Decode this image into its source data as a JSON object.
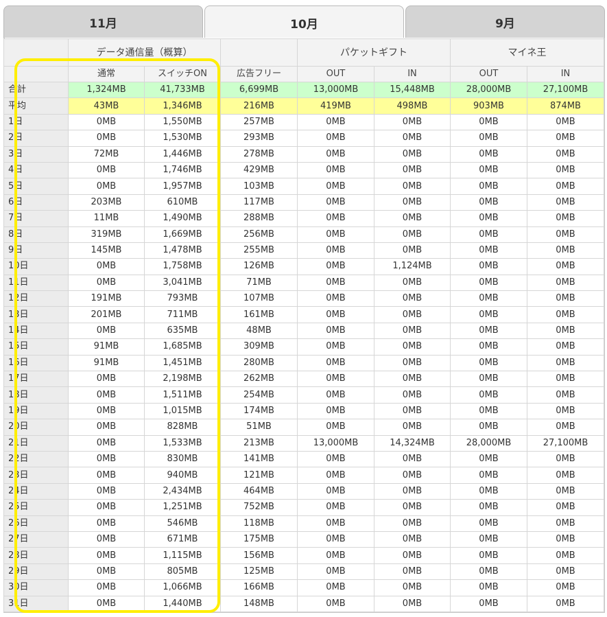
{
  "tabs": [
    {
      "label": "11月",
      "active": false
    },
    {
      "label": "10月",
      "active": true
    },
    {
      "label": "9月",
      "active": false
    }
  ],
  "header": {
    "group1": "データ通信量（概算）",
    "group2": "パケットギフト",
    "group3": "マイネ王",
    "col_normal": "通常",
    "col_switch": "スイッチON",
    "col_adfree": "広告フリー",
    "col_gift_out": "OUT",
    "col_gift_in": "IN",
    "col_mine_out": "OUT",
    "col_mine_in": "IN"
  },
  "summary": {
    "total": {
      "label": "合計",
      "values": [
        "1,324MB",
        "41,733MB",
        "6,699MB",
        "13,000MB",
        "15,448MB",
        "28,000MB",
        "27,100MB"
      ]
    },
    "average": {
      "label": "平均",
      "values": [
        "43MB",
        "1,346MB",
        "216MB",
        "419MB",
        "498MB",
        "903MB",
        "874MB"
      ]
    }
  },
  "rows": [
    {
      "day": "1日",
      "values": [
        "0MB",
        "1,550MB",
        "257MB",
        "0MB",
        "0MB",
        "0MB",
        "0MB"
      ]
    },
    {
      "day": "2日",
      "values": [
        "0MB",
        "1,530MB",
        "293MB",
        "0MB",
        "0MB",
        "0MB",
        "0MB"
      ]
    },
    {
      "day": "3日",
      "values": [
        "72MB",
        "1,446MB",
        "278MB",
        "0MB",
        "0MB",
        "0MB",
        "0MB"
      ]
    },
    {
      "day": "4日",
      "values": [
        "0MB",
        "1,746MB",
        "429MB",
        "0MB",
        "0MB",
        "0MB",
        "0MB"
      ]
    },
    {
      "day": "5日",
      "values": [
        "0MB",
        "1,957MB",
        "103MB",
        "0MB",
        "0MB",
        "0MB",
        "0MB"
      ]
    },
    {
      "day": "6日",
      "values": [
        "203MB",
        "610MB",
        "117MB",
        "0MB",
        "0MB",
        "0MB",
        "0MB"
      ]
    },
    {
      "day": "7日",
      "values": [
        "11MB",
        "1,490MB",
        "288MB",
        "0MB",
        "0MB",
        "0MB",
        "0MB"
      ]
    },
    {
      "day": "8日",
      "values": [
        "319MB",
        "1,669MB",
        "256MB",
        "0MB",
        "0MB",
        "0MB",
        "0MB"
      ]
    },
    {
      "day": "9日",
      "values": [
        "145MB",
        "1,478MB",
        "255MB",
        "0MB",
        "0MB",
        "0MB",
        "0MB"
      ]
    },
    {
      "day": "10日",
      "values": [
        "0MB",
        "1,758MB",
        "126MB",
        "0MB",
        "1,124MB",
        "0MB",
        "0MB"
      ]
    },
    {
      "day": "11日",
      "values": [
        "0MB",
        "3,041MB",
        "71MB",
        "0MB",
        "0MB",
        "0MB",
        "0MB"
      ]
    },
    {
      "day": "12日",
      "values": [
        "191MB",
        "793MB",
        "107MB",
        "0MB",
        "0MB",
        "0MB",
        "0MB"
      ]
    },
    {
      "day": "13日",
      "values": [
        "201MB",
        "711MB",
        "161MB",
        "0MB",
        "0MB",
        "0MB",
        "0MB"
      ]
    },
    {
      "day": "14日",
      "values": [
        "0MB",
        "635MB",
        "48MB",
        "0MB",
        "0MB",
        "0MB",
        "0MB"
      ]
    },
    {
      "day": "15日",
      "values": [
        "91MB",
        "1,685MB",
        "309MB",
        "0MB",
        "0MB",
        "0MB",
        "0MB"
      ]
    },
    {
      "day": "16日",
      "values": [
        "91MB",
        "1,451MB",
        "280MB",
        "0MB",
        "0MB",
        "0MB",
        "0MB"
      ]
    },
    {
      "day": "17日",
      "values": [
        "0MB",
        "2,198MB",
        "262MB",
        "0MB",
        "0MB",
        "0MB",
        "0MB"
      ]
    },
    {
      "day": "18日",
      "values": [
        "0MB",
        "1,511MB",
        "254MB",
        "0MB",
        "0MB",
        "0MB",
        "0MB"
      ]
    },
    {
      "day": "19日",
      "values": [
        "0MB",
        "1,015MB",
        "174MB",
        "0MB",
        "0MB",
        "0MB",
        "0MB"
      ]
    },
    {
      "day": "20日",
      "values": [
        "0MB",
        "828MB",
        "51MB",
        "0MB",
        "0MB",
        "0MB",
        "0MB"
      ]
    },
    {
      "day": "21日",
      "values": [
        "0MB",
        "1,533MB",
        "213MB",
        "13,000MB",
        "14,324MB",
        "28,000MB",
        "27,100MB"
      ]
    },
    {
      "day": "22日",
      "values": [
        "0MB",
        "830MB",
        "141MB",
        "0MB",
        "0MB",
        "0MB",
        "0MB"
      ]
    },
    {
      "day": "23日",
      "values": [
        "0MB",
        "940MB",
        "121MB",
        "0MB",
        "0MB",
        "0MB",
        "0MB"
      ]
    },
    {
      "day": "24日",
      "values": [
        "0MB",
        "2,434MB",
        "464MB",
        "0MB",
        "0MB",
        "0MB",
        "0MB"
      ]
    },
    {
      "day": "25日",
      "values": [
        "0MB",
        "1,251MB",
        "752MB",
        "0MB",
        "0MB",
        "0MB",
        "0MB"
      ]
    },
    {
      "day": "26日",
      "values": [
        "0MB",
        "546MB",
        "118MB",
        "0MB",
        "0MB",
        "0MB",
        "0MB"
      ]
    },
    {
      "day": "27日",
      "values": [
        "0MB",
        "671MB",
        "175MB",
        "0MB",
        "0MB",
        "0MB",
        "0MB"
      ]
    },
    {
      "day": "28日",
      "values": [
        "0MB",
        "1,115MB",
        "156MB",
        "0MB",
        "0MB",
        "0MB",
        "0MB"
      ]
    },
    {
      "day": "29日",
      "values": [
        "0MB",
        "805MB",
        "125MB",
        "0MB",
        "0MB",
        "0MB",
        "0MB"
      ]
    },
    {
      "day": "30日",
      "values": [
        "0MB",
        "1,066MB",
        "166MB",
        "0MB",
        "0MB",
        "0MB",
        "0MB"
      ]
    },
    {
      "day": "31日",
      "values": [
        "0MB",
        "1,440MB",
        "148MB",
        "0MB",
        "0MB",
        "0MB",
        "0MB"
      ]
    }
  ],
  "colors": {
    "total_row": "#ccffcc",
    "average_row": "#ffff99",
    "highlight_border": "#ffee00"
  }
}
